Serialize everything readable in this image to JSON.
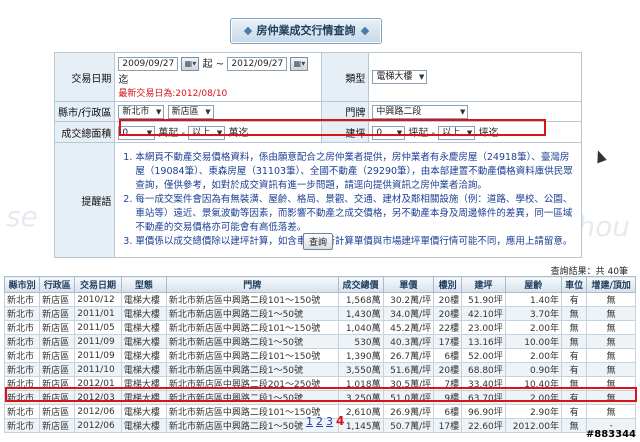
{
  "page_title": "房仲業成交行情查詢",
  "form": {
    "trade_date_label": "交易日期",
    "date_from": "2009/09/27",
    "date_sep": "起 ~",
    "date_to": "2012/09/27",
    "date_end": "迄",
    "latest_note": "最新交易日為:2012/08/10",
    "type_label": "類型",
    "type_value": "電梯大樓",
    "region_label": "縣市/行政區",
    "city_value": "新北市",
    "district_value": "新店區",
    "door_label": "門牌",
    "door_value": "中興路二段",
    "area_label": "成交總面積",
    "area_from": "0",
    "area_unit1": "萬起 -",
    "area_to": "以上",
    "area_unit2": "萬迄",
    "build_label": "建坪",
    "build_from": "0",
    "build_unit1": "坪起 -",
    "build_to": "以上",
    "build_unit2": "坪迄",
    "notes_label": "提醒語",
    "notes": [
      "本網頁不動產交易價格資料，係由願意配合之房仲業者提供，房仲業者有永慶房屋（24918筆）、臺灣房屋（19084筆）、東森房屋（31103筆）、全國不動產（29290筆），由本部建置不動產價格資料庫供民眾查詢，僅供參考，如對於成交資訊有進一步問題，請逕向提供資訊之房仲業者洽詢。",
      "每一成交案件會因為有無裝潢、屋齡、格局、景觀、交通、建材及鄰相關設施（例：道路、學校、公園、車站等）遠近、景氣波動等因素，而影響不動產之成交價格，另不動產本身及周邊條件的差異，同一區域不動產的交易價格亦可能會有高低落差。",
      "單價係以成交總價除以建坪計算，如含車位則所計算單價與市場建坪單價行情可能不同，應用上請留意。"
    ],
    "search_button": "查詢"
  },
  "results": {
    "count_text": "查詢結果：共 40筆",
    "headers": [
      "縣市別",
      "行政區",
      "交易日期",
      "型態",
      "門牌",
      "成交總價",
      "單價",
      "樓別",
      "建坪",
      "屋齡",
      "車位",
      "增建/頂加"
    ],
    "rows": [
      [
        "新北市",
        "新店區",
        "2010/12",
        "電梯大樓",
        "新北市新店區中興路二段101～150號",
        "1,568萬",
        "30.2萬/坪",
        "20樓",
        "51.90坪",
        "1.40年",
        "有",
        "無"
      ],
      [
        "新北市",
        "新店區",
        "2011/01",
        "電梯大樓",
        "新北市新店區中興路二段1～50號",
        "1,430萬",
        "34.0萬/坪",
        "20樓",
        "42.10坪",
        "3.70年",
        "無",
        "無"
      ],
      [
        "新北市",
        "新店區",
        "2011/05",
        "電梯大樓",
        "新北市新店區中興路二段101～150號",
        "1,040萬",
        "45.2萬/坪",
        "22樓",
        "23.00坪",
        "2.00年",
        "無",
        "無"
      ],
      [
        "新北市",
        "新店區",
        "2011/09",
        "電梯大樓",
        "新北市新店區中興路二段1～50號",
        "530萬",
        "40.3萬/坪",
        "17樓",
        "13.16坪",
        "10.00年",
        "無",
        "無"
      ],
      [
        "新北市",
        "新店區",
        "2011/09",
        "電梯大樓",
        "新北市新店區中興路二段101～150號",
        "1,390萬",
        "26.7萬/坪",
        "6樓",
        "52.00坪",
        "2.00年",
        "有",
        "無"
      ],
      [
        "新北市",
        "新店區",
        "2011/10",
        "電梯大樓",
        "新北市新店區中興路二段1～50號",
        "3,550萬",
        "51.6萬/坪",
        "20樓",
        "68.80坪",
        "0.90年",
        "有",
        "無"
      ],
      [
        "新北市",
        "新店區",
        "2012/01",
        "電梯大樓",
        "新北市新店區中興路二段201～250號",
        "1,018萬",
        "30.5萬/坪",
        "7樓",
        "33.40坪",
        "10.40年",
        "無",
        "無"
      ],
      [
        "新北市",
        "新店區",
        "2012/03",
        "電梯大樓",
        "新北市新店區中興路二段1～50號",
        "3,250萬",
        "51.0萬/坪",
        "9樓",
        "63.70坪",
        "2.00年",
        "有",
        "無"
      ],
      [
        "新北市",
        "新店區",
        "2012/06",
        "電梯大樓",
        "新北市新店區中興路二段101～150號",
        "2,610萬",
        "26.9萬/坪",
        "6樓",
        "96.90坪",
        "2.90年",
        "有",
        "無"
      ],
      [
        "新北市",
        "新店區",
        "2012/06",
        "電梯大樓",
        "新北市新店區中興路二段1～50號",
        "1,145萬",
        "50.7萬/坪",
        "17樓",
        "22.60坪",
        "2012.00年",
        "無",
        "-"
      ]
    ]
  },
  "pager": [
    "1",
    "2",
    "3",
    "4"
  ],
  "watermark": "#883344"
}
